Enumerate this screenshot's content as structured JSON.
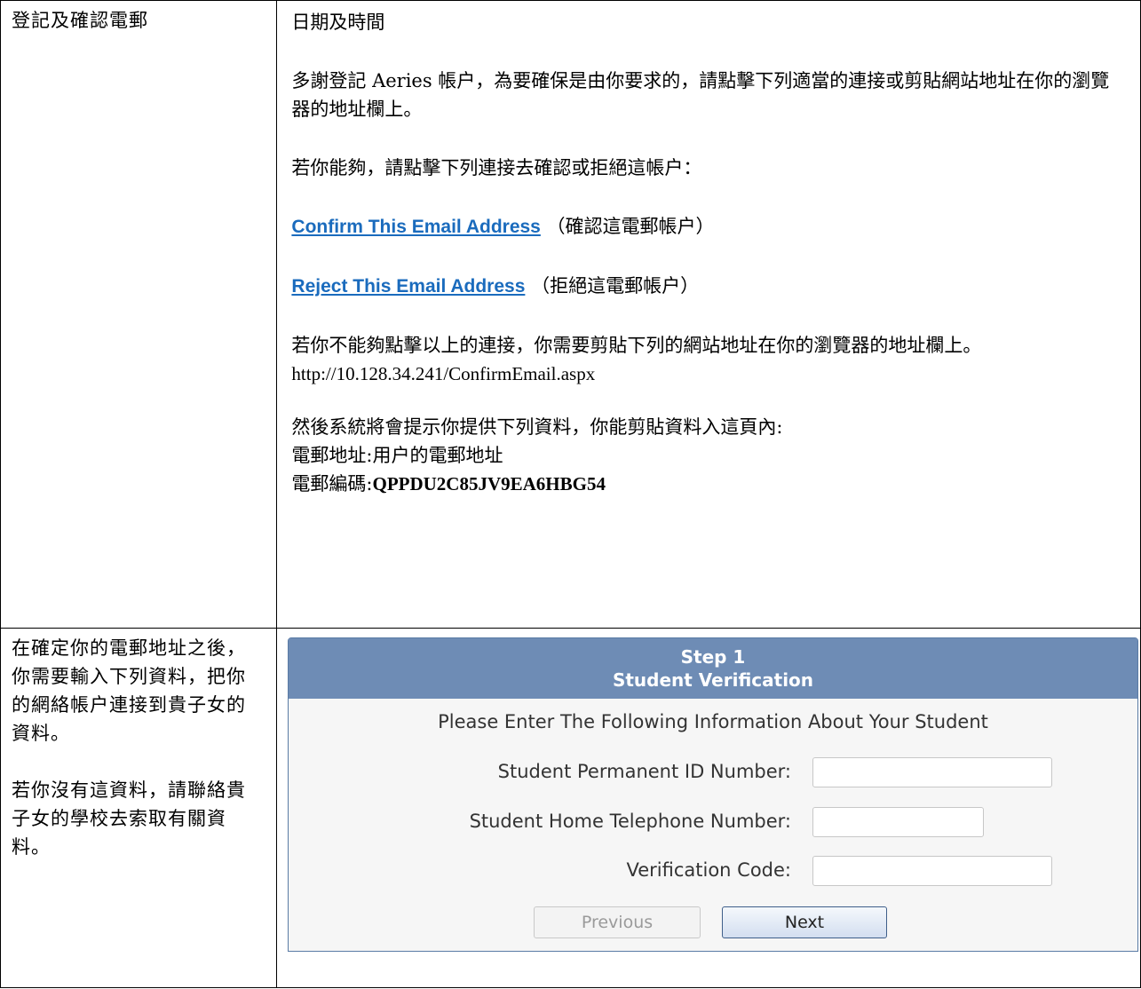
{
  "left": {
    "row1": "登記及確認電郵",
    "row2_para1": "在確定你的電郵地址之後，你需要輸入下列資料，把你的網絡帳户連接到貴子女的資料。",
    "row2_para2": "若你沒有這資料，請聯絡貴子女的學校去索取有關資料。"
  },
  "right": {
    "date_time": "日期及時間",
    "intro": "多謝登記 Aeries 帳户，為要確保是由你要求的，請點擊下列適當的連接或剪貼網站地址在你的瀏覽器的地址欄上。",
    "ability": "若你能夠，請點擊下列連接去確認或拒絕這帳户：",
    "confirm_link": "Confirm This Email Address",
    "confirm_note": "（確認這電郵帳户）",
    "reject_link": "Reject This Email Address",
    "reject_note": "（拒絕這電郵帳户）",
    "cannot_click": "若你不能夠點擊以上的連接，你需要剪貼下列的網站地址在你的瀏覽器的地址欄上。",
    "url": "http://10.128.34.241/ConfirmEmail.aspx",
    "then": "然後系統將會提示你提供下列資料，你能剪貼資料入這頁內:",
    "email_label": "電郵地址:",
    "email_value": "用户的電郵地址",
    "code_label": "電郵編碼:",
    "code_value": "QPPDU2C85JV9EA6HBG54"
  },
  "step": {
    "title_line1": "Step 1",
    "title_line2": "Student Verification",
    "intro": "Please Enter The Following Information About Your Student",
    "fields": [
      {
        "label": "Student Permanent ID Number:",
        "value": ""
      },
      {
        "label": "Student Home Telephone Number:",
        "value": ""
      },
      {
        "label": "Verification Code:",
        "value": ""
      }
    ],
    "prev_label": "Previous",
    "next_label": "Next"
  },
  "colors": {
    "link": "#1a6bbd",
    "step_header": "#6e8cb5",
    "step_border": "#5a7ba5"
  }
}
